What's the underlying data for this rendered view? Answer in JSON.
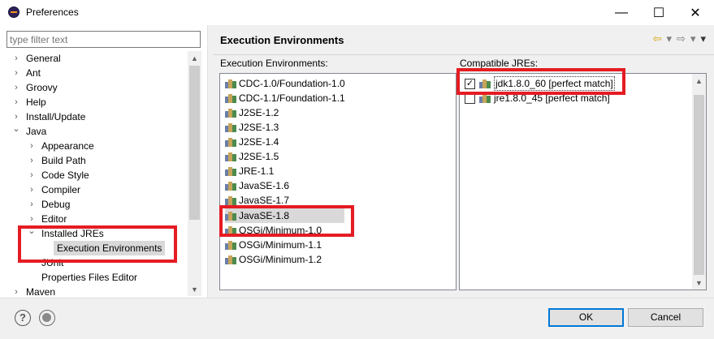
{
  "window": {
    "title": "Preferences",
    "minimize": "—",
    "maximize": "☐",
    "close": "✕"
  },
  "filter": {
    "placeholder": "type filter text"
  },
  "tree": [
    {
      "label": "General",
      "twisty": "›"
    },
    {
      "label": "Ant",
      "twisty": "›"
    },
    {
      "label": "Groovy",
      "twisty": "›"
    },
    {
      "label": "Help",
      "twisty": "›"
    },
    {
      "label": "Install/Update",
      "twisty": "›"
    },
    {
      "label": "Java",
      "twisty": "⌄"
    },
    {
      "label": "Appearance",
      "twisty": "›"
    },
    {
      "label": "Build Path",
      "twisty": "›"
    },
    {
      "label": "Code Style",
      "twisty": "›"
    },
    {
      "label": "Compiler",
      "twisty": "›"
    },
    {
      "label": "Debug",
      "twisty": "›"
    },
    {
      "label": "Editor",
      "twisty": "›"
    },
    {
      "label": "Installed JREs",
      "twisty": "⌄"
    },
    {
      "label": "Execution Environments",
      "twisty": ""
    },
    {
      "label": "JUnit",
      "twisty": ""
    },
    {
      "label": "Properties Files Editor",
      "twisty": ""
    },
    {
      "label": "Maven",
      "twisty": "›"
    }
  ],
  "page": {
    "title": "Execution Environments",
    "envs_label": "Execution Environments:",
    "jres_label": "Compatible JREs:",
    "nav": {
      "back": "⇦",
      "forward": "⇨",
      "menu": "▾"
    }
  },
  "environments": [
    "CDC-1.0/Foundation-1.0",
    "CDC-1.1/Foundation-1.1",
    "J2SE-1.2",
    "J2SE-1.3",
    "J2SE-1.4",
    "J2SE-1.5",
    "JRE-1.1",
    "JavaSE-1.6",
    "JavaSE-1.7",
    "JavaSE-1.8",
    "OSGi/Minimum-1.0",
    "OSGi/Minimum-1.1",
    "OSGi/Minimum-1.2"
  ],
  "selected_environment": "JavaSE-1.8",
  "jres": [
    {
      "label": "jdk1.8.0_60 [perfect match]",
      "checked": true,
      "mark": "✓"
    },
    {
      "label": "jre1.8.0_45 [perfect match]",
      "checked": false,
      "mark": ""
    }
  ],
  "footer": {
    "help": "?",
    "ok": "OK",
    "cancel": "Cancel"
  },
  "colors": {
    "highlight": "#e51c23",
    "default_button_border": "#0078d7"
  }
}
